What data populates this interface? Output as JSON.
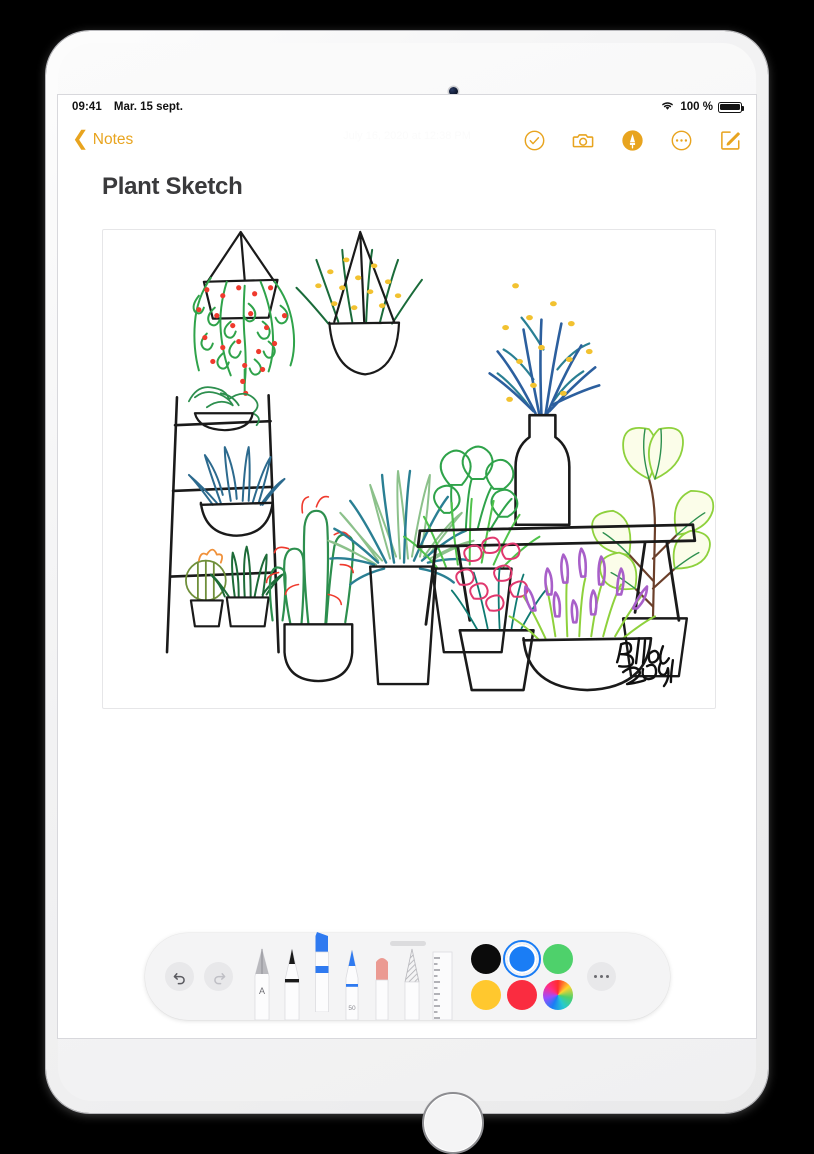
{
  "device": {
    "name": "iPad",
    "camera": "front-camera",
    "home_button": "home-button"
  },
  "status_bar": {
    "time": "09:41",
    "date": "Mar. 15 sept.",
    "wifi_icon": "wifi-icon",
    "battery_percent": "100 %",
    "battery_icon": "battery-full-icon"
  },
  "nav": {
    "back_label": "Notes",
    "back_chevron_icon": "chevron-left-icon",
    "document_timestamp": "July 16, 2020 at 12:38 PM",
    "accent_color": "#e8a41f",
    "actions": [
      {
        "name": "checklist-button",
        "icon": "check-circle-icon",
        "label": "Checklist",
        "active": false
      },
      {
        "name": "camera-button",
        "icon": "camera-icon",
        "label": "Insert Media",
        "active": false
      },
      {
        "name": "markup-button",
        "icon": "markup-pen-icon",
        "label": "Markup",
        "active": true
      },
      {
        "name": "more-button",
        "icon": "ellipsis-circle-icon",
        "label": "More",
        "active": false
      },
      {
        "name": "compose-button",
        "icon": "compose-icon",
        "label": "New Note",
        "active": false
      }
    ]
  },
  "note": {
    "title": "Plant Sketch",
    "title_color": "#3a3a3c",
    "drawing": {
      "name": "plant-sketch-drawing",
      "signature": "Bella",
      "signature_year": "2019",
      "subjects": [
        "hanging planter with red-flowering trailing vine",
        "hanging planter with yellow-flowering spiky plant",
        "ladder shelf with trailing succulent, blue agave bowl, orange-flower cactus and dark green cactus",
        "tall orange-flowering cactus",
        "teal and sage bamboo-leaf plant in tall tapered pot",
        "heart-leaf philodendron and green grass in tapered pot",
        "blue and teal lavender-like stems in white bottle vase",
        "variegated yellow-green calathea in tapered pot",
        "pink flowering plant in tapered pot",
        "purple lavender in wide bowl",
        "wooden bench"
      ],
      "palette": {
        "outline": "#1a1a1a",
        "leaf_green": "#2fa34a",
        "sage_green": "#8cc18b",
        "teal": "#2a7f93",
        "deep_blue": "#2c5f9e",
        "steel_blue": "#3f6fa8",
        "yellow": "#f2c230",
        "red": "#ef3a2d",
        "orange": "#f07030",
        "pink": "#e0386e",
        "purple": "#a85fc9",
        "lime": "#8ed13c",
        "brown": "#6b3f2a",
        "olive": "#6f8f3a"
      }
    }
  },
  "palette_bar": {
    "grabber": "drag-handle",
    "undo": {
      "name": "undo-button",
      "label": "Undo",
      "enabled": true
    },
    "redo": {
      "name": "redo-button",
      "label": "Redo",
      "enabled": false
    },
    "tools": [
      {
        "name": "tool-pen",
        "label": "Pen",
        "tip_label": "A",
        "selected": false,
        "color": "#9d9da2"
      },
      {
        "name": "tool-marker",
        "label": "Marker",
        "tip_label": "",
        "selected": false,
        "color": "#1a1a1a"
      },
      {
        "name": "tool-highlighter",
        "label": "Highlighter",
        "tip_label": "",
        "selected": true,
        "color": "#2f7af0"
      },
      {
        "name": "tool-pencil",
        "label": "Pencil",
        "tip_label": "50",
        "selected": false,
        "color": "#2f7af0"
      },
      {
        "name": "tool-eraser",
        "label": "Eraser",
        "tip_label": "",
        "selected": false,
        "color": "#eb9a92"
      },
      {
        "name": "tool-lasso",
        "label": "Lasso",
        "tip_label": "",
        "selected": false,
        "color": "#b8b8bd"
      },
      {
        "name": "tool-ruler",
        "label": "Ruler",
        "tip_label": "",
        "selected": false,
        "color": "#d2d2d6"
      }
    ],
    "colors": [
      {
        "name": "swatch-black",
        "hex": "#0b0b0b",
        "selected": false
      },
      {
        "name": "swatch-blue",
        "hex": "#1a7df5",
        "selected": true
      },
      {
        "name": "swatch-green",
        "hex": "#4ed16b",
        "selected": false
      },
      {
        "name": "swatch-yellow",
        "hex": "#ffc82e",
        "selected": false
      },
      {
        "name": "swatch-red",
        "hex": "#fa2c40",
        "selected": false
      },
      {
        "name": "swatch-color-wheel",
        "hex": "wheel",
        "selected": false
      }
    ],
    "more": {
      "name": "palette-more-button",
      "icon": "ellipsis-icon",
      "label": "More"
    }
  }
}
